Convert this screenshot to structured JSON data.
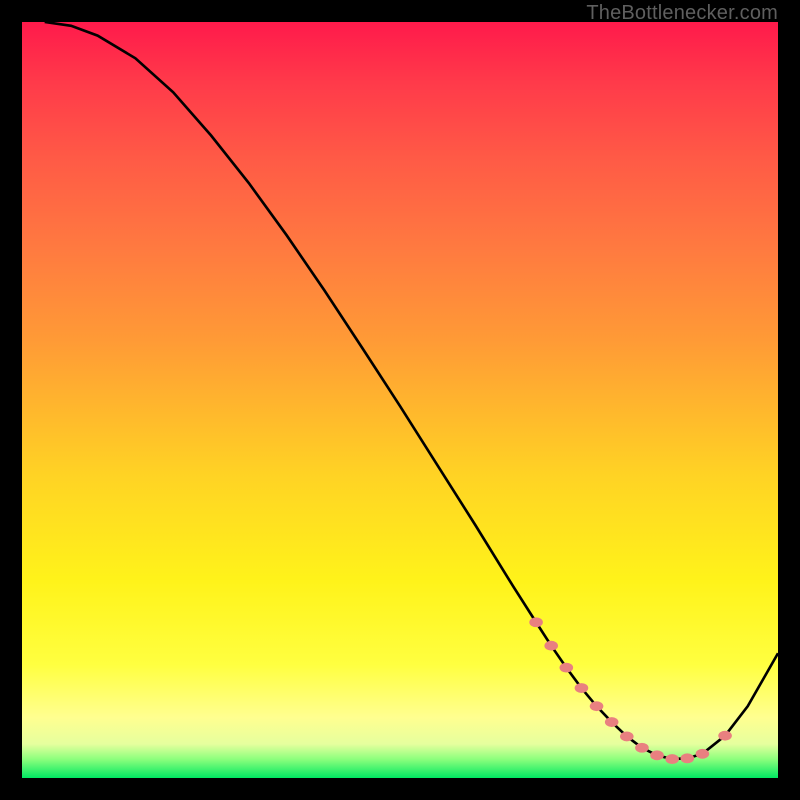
{
  "attribution": "TheBottlenecker.com",
  "chart_data": {
    "type": "line",
    "title": "",
    "xlabel": "",
    "ylabel": "",
    "xlim": [
      0,
      100
    ],
    "ylim": [
      0,
      100
    ],
    "series": [
      {
        "name": "bottleneck-curve",
        "x": [
          3,
          6.5,
          10,
          15,
          20,
          25,
          30,
          35,
          40,
          45,
          50,
          55,
          60,
          65,
          68,
          70,
          72,
          74,
          76,
          78,
          80,
          82,
          84,
          86,
          88,
          90,
          93,
          96,
          100
        ],
        "y": [
          100,
          99.5,
          98.2,
          95.2,
          90.7,
          85,
          78.7,
          71.8,
          64.5,
          56.9,
          49.2,
          41.3,
          33.4,
          25.3,
          20.6,
          17.5,
          14.6,
          11.9,
          9.5,
          7.4,
          5.5,
          4.0,
          3.0,
          2.5,
          2.6,
          3.2,
          5.6,
          9.5,
          16.5
        ]
      }
    ],
    "highlight_markers": {
      "name": "optimal-range",
      "x": [
        68,
        70,
        72,
        74,
        76,
        78,
        80,
        82,
        84,
        86,
        88,
        90,
        93
      ],
      "y": [
        20.6,
        17.5,
        14.6,
        11.9,
        9.5,
        7.4,
        5.5,
        4.0,
        3.0,
        2.5,
        2.6,
        3.2,
        5.6
      ]
    },
    "marker_color": "#e98080",
    "line_color": "#000000"
  }
}
